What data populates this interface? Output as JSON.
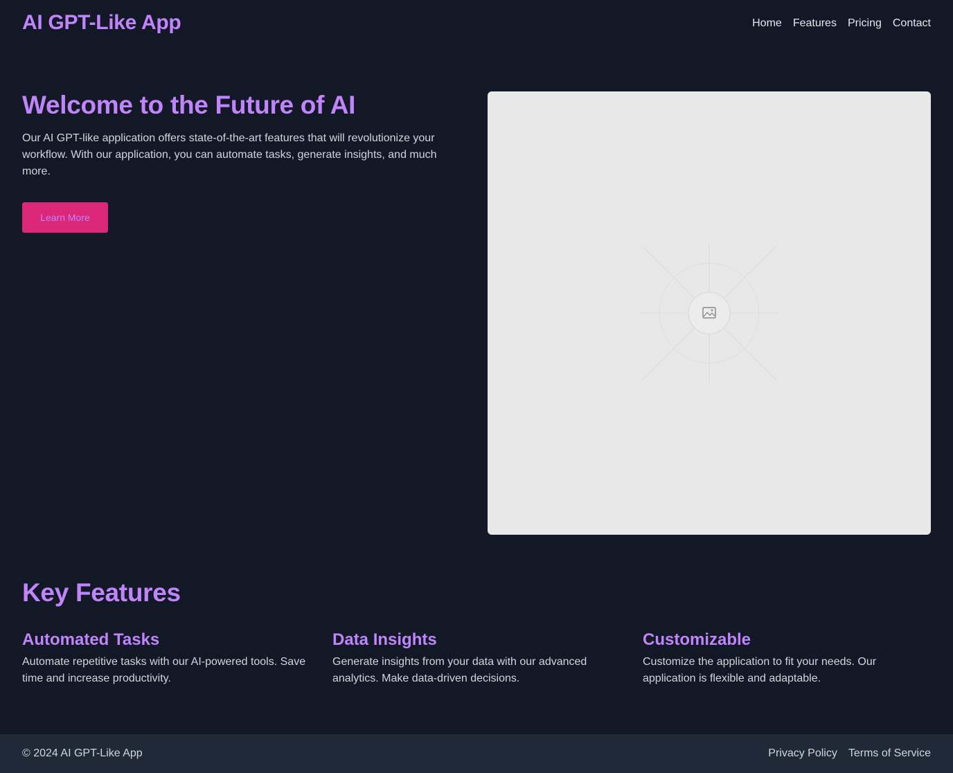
{
  "header": {
    "logo": "AI GPT-Like App",
    "nav": [
      "Home",
      "Features",
      "Pricing",
      "Contact"
    ]
  },
  "hero": {
    "title": "Welcome to the Future of AI",
    "text": "Our AI GPT-like application offers state-of-the-art features that will revolutionize your workflow. With our application, you can automate tasks, generate insights, and much more.",
    "cta_label": "Learn More",
    "image_icon": "image-placeholder-icon"
  },
  "features": {
    "title": "Key Features",
    "items": [
      {
        "title": "Automated Tasks",
        "text": "Automate repetitive tasks with our AI-powered tools. Save time and increase productivity."
      },
      {
        "title": "Data Insights",
        "text": "Generate insights from your data with our advanced analytics. Make data-driven decisions."
      },
      {
        "title": "Customizable",
        "text": "Customize the application to fit your needs. Our application is flexible and adaptable."
      }
    ]
  },
  "footer": {
    "copyright": "© 2024 AI GPT-Like App",
    "links": [
      "Privacy Policy",
      "Terms of Service"
    ]
  },
  "colors": {
    "background": "#121826",
    "accent": "#c084fc",
    "button": "#db2777",
    "footer_background": "#1f2937",
    "image_placeholder": "#e8e8e8"
  }
}
